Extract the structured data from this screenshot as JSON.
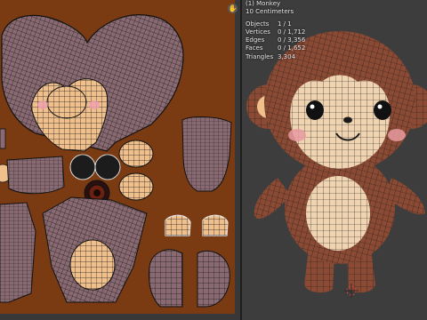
{
  "viewport": {
    "object_name": "(1) Monkey",
    "scale_label": "10 Centimeters",
    "stats": [
      {
        "key": "Objects",
        "value": "1 / 1"
      },
      {
        "key": "Vertices",
        "value": "0 / 1,712"
      },
      {
        "key": "Edges",
        "value": "0 / 3,356"
      },
      {
        "key": "Faces",
        "value": "0 / 1,652"
      },
      {
        "key": "Triangles",
        "value": "3,304"
      }
    ]
  },
  "uv_editor": {
    "hand_icon": "hand-icon"
  },
  "colors": {
    "uv_background": "#7a3a12",
    "uv_island": "#8a6a72",
    "skin": "#f0c08c",
    "fur": "#8b4a34",
    "wire": "#1a1a1a"
  }
}
